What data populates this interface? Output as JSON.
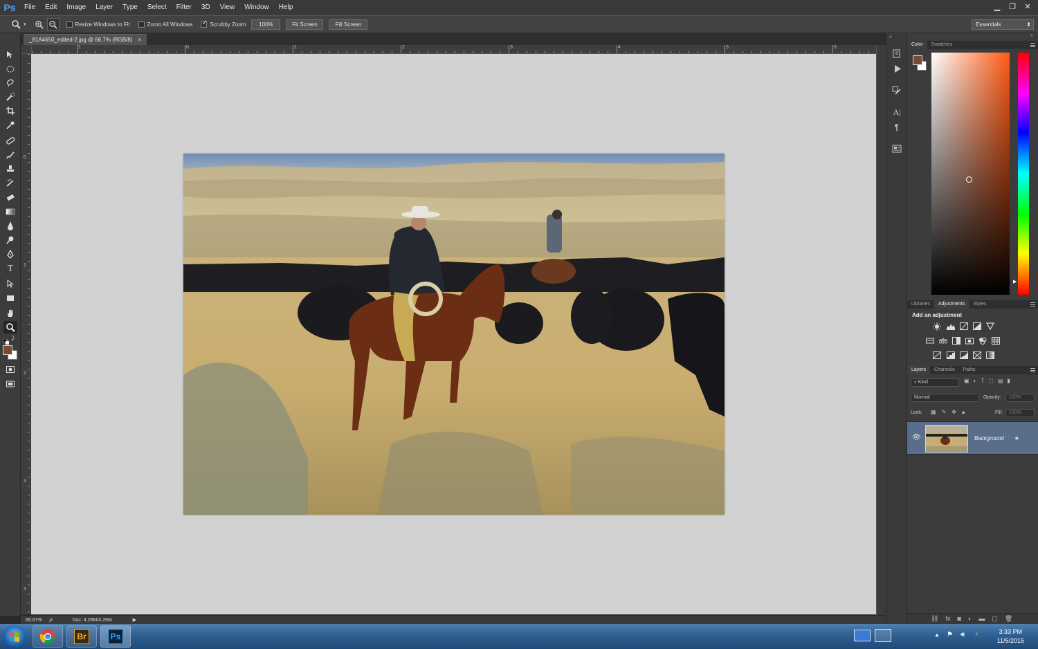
{
  "menubar": {
    "logo": "Ps",
    "items": [
      "File",
      "Edit",
      "Image",
      "Layer",
      "Type",
      "Select",
      "Filter",
      "3D",
      "View",
      "Window",
      "Help"
    ]
  },
  "options": {
    "resize_windows": "Resize Windows to Fit",
    "zoom_all": "Zoom All Windows",
    "scrubby_zoom": "Scrubby Zoom",
    "zoom_value": "100%",
    "fit_screen": "Fit Screen",
    "fill_screen": "Fill Screen",
    "workspace": "Essentials"
  },
  "document": {
    "tab_title": "_81A4650_edited-2.jpg @ 66.7% (RGB/8)",
    "close": "×",
    "ruler_h_labels": [
      "1",
      "0",
      "1",
      "2",
      "3",
      "4",
      "5",
      "6"
    ],
    "ruler_v_labels": [
      "0",
      "1",
      "2",
      "3",
      "4"
    ]
  },
  "status": {
    "zoom": "66.67%",
    "doc_info": "Doc: 4.29M/4.29M"
  },
  "panels": {
    "color_tabs": [
      "Color",
      "Swatches"
    ],
    "fg_color": "#7b4a34",
    "lib_tabs": [
      "Libraries",
      "Adjustments",
      "Styles"
    ],
    "adjust_title": "Add an adjustment",
    "layer_tabs": [
      "Layers",
      "Channels",
      "Paths"
    ],
    "kind": "Kind",
    "blend": "Normal",
    "opacity_label": "Opacity:",
    "opacity_value": "100%",
    "lock_label": "Lock:",
    "fill_label": "Fill:",
    "fill_value": "100%",
    "layer_name": "Background"
  },
  "taskbar": {
    "apps": [
      "chrome",
      "Br",
      "Ps"
    ],
    "time": "3:33 PM",
    "date": "11/5/2015"
  }
}
